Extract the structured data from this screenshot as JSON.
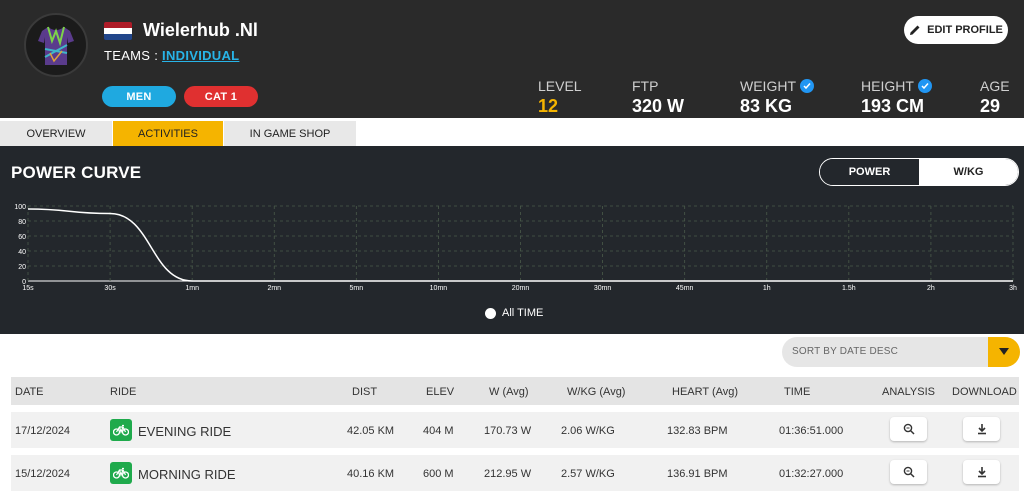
{
  "profile": {
    "username": "Wielerhub .Nl",
    "teams_label": "TEAMS : ",
    "team_name": "INDIVIDUAL",
    "badges": {
      "gender": "MEN",
      "category": "CAT 1"
    },
    "edit_label": "EDIT PROFILE"
  },
  "stats": [
    {
      "label": "LEVEL",
      "value": "12"
    },
    {
      "label": "FTP",
      "value": "320 W"
    },
    {
      "label": "WEIGHT",
      "value": "83 KG"
    },
    {
      "label": "HEIGHT",
      "value": "193 CM"
    },
    {
      "label": "AGE",
      "value": "29"
    }
  ],
  "tabs": [
    "OVERVIEW",
    "ACTIVITIES",
    "IN GAME SHOP"
  ],
  "active_tab": "ACTIVITIES",
  "power_curve": {
    "title": "POWER CURVE",
    "toggle": [
      "POWER",
      "W/KG"
    ],
    "active_toggle": "W/KG",
    "legend": "All TIME"
  },
  "chart_data": {
    "type": "line",
    "categories": [
      "15s",
      "30s",
      "1mn",
      "2mn",
      "5mn",
      "10mn",
      "20mn",
      "30mn",
      "45mn",
      "1h",
      "1.5h",
      "2h",
      "3h"
    ],
    "yticks": [
      100,
      80,
      60,
      40,
      20,
      0
    ],
    "ylim": [
      0,
      100
    ],
    "grid": true,
    "series": [
      {
        "x": [
          "15s",
          "30s",
          "1mn",
          "2mn",
          "5mn",
          "10mn",
          "20mn",
          "30mn",
          "45mn",
          "1h",
          "1.5h",
          "2h",
          "3h"
        ],
        "values": [
          96,
          90,
          0,
          0,
          0,
          0,
          0,
          0,
          0,
          0,
          0,
          0,
          0
        ]
      }
    ]
  },
  "sort": {
    "label": "SORT BY DATE DESC"
  },
  "table": {
    "columns": [
      "DATE",
      "RIDE",
      "DIST",
      "ELEV",
      "W (Avg)",
      "W/KG (Avg)",
      "HEART (Avg)",
      "TIME",
      "ANALYSIS",
      "DOWNLOAD"
    ],
    "rows": [
      {
        "date": "17/12/2024",
        "ride": "EVENING RIDE",
        "dist": "42.05 KM",
        "elev": "404 M",
        "w": "170.73 W",
        "wkg": "2.06 W/KG",
        "heart": "132.83 BPM",
        "time": "01:36:51.000"
      },
      {
        "date": "15/12/2024",
        "ride": "MORNING RIDE",
        "dist": "40.16 KM",
        "elev": "600 M",
        "w": "212.95 W",
        "wkg": "2.57 W/KG",
        "heart": "136.91 BPM",
        "time": "01:32:27.000"
      }
    ]
  },
  "colors": {
    "accent": "#f5b400",
    "men_badge": "#1fa9e0",
    "cat_badge": "#e03030",
    "ride_icon": "#1faa4c",
    "header_bg": "#2a2a2a",
    "chart_bg": "#23272c"
  }
}
